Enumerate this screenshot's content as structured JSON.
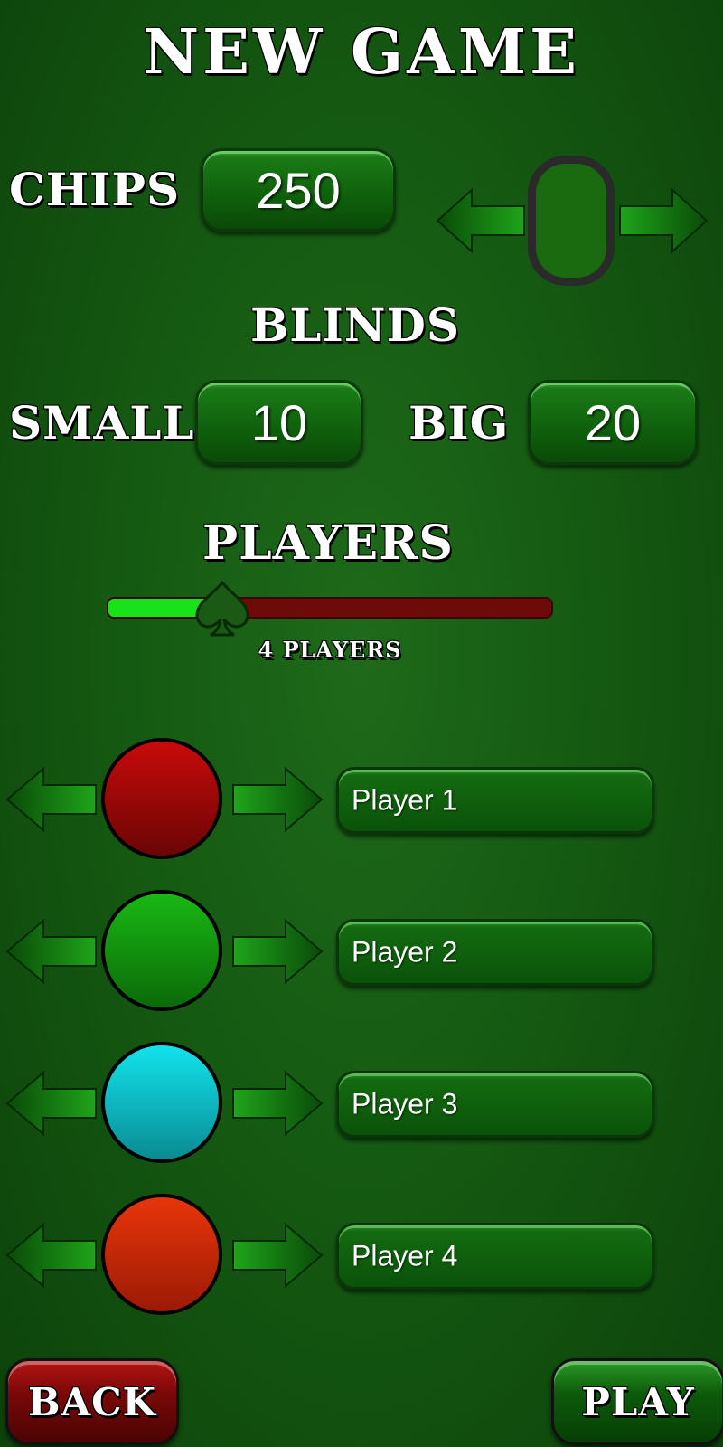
{
  "title": "NEW GAME",
  "chips": {
    "label": "CHIPS",
    "value": "250"
  },
  "blinds": {
    "label": "BLINDS",
    "small_label": "SMALL",
    "small_value": "10",
    "big_label": "BIG",
    "big_value": "20"
  },
  "players_section": {
    "label": "PLAYERS",
    "slider_text": "4 PLAYERS",
    "slider_fraction": 0.26
  },
  "players": [
    {
      "name": "Player 1",
      "color_top": "#c80a0a",
      "color_bottom": "#6b0505"
    },
    {
      "name": "Player 2",
      "color_top": "#19b814",
      "color_bottom": "#0b6a09"
    },
    {
      "name": "Player 3",
      "color_top": "#12e3ec",
      "color_bottom": "#0a8b93"
    },
    {
      "name": "Player 4",
      "color_top": "#e8350a",
      "color_bottom": "#9c1a05"
    }
  ],
  "buttons": {
    "back": "BACK",
    "play": "PLAY"
  },
  "colors": {
    "background": "#155a12",
    "slider_fill": "#17e21a",
    "slider_track": "#6e0a08",
    "back_button": "#7a0808",
    "play_button": "#0d5a0a"
  }
}
